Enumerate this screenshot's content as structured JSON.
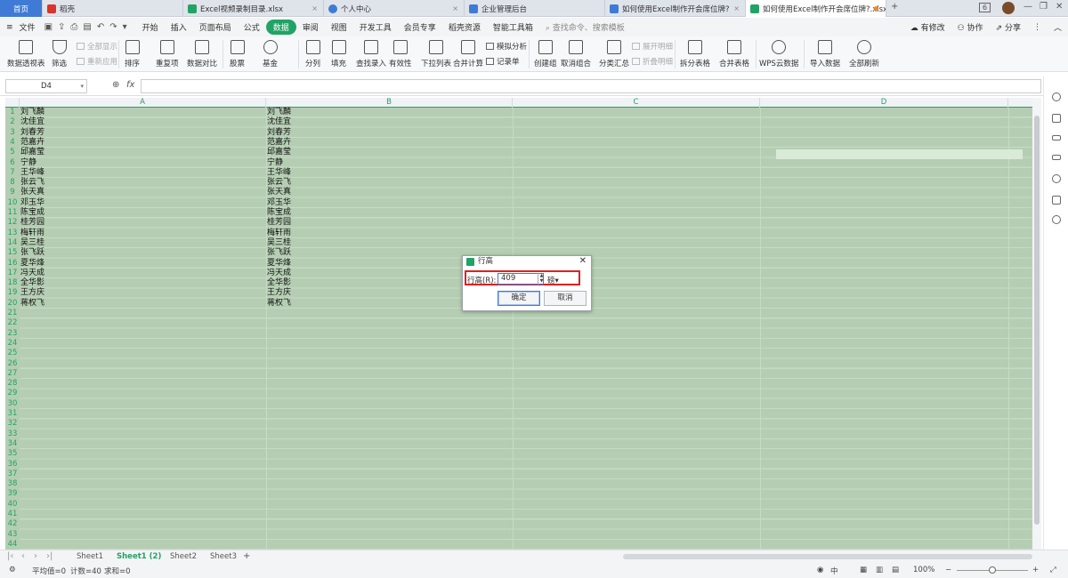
{
  "tabs": {
    "home": "首页",
    "docs": [
      {
        "label": "稻壳",
        "icon_color": "#d9342b",
        "closable": false
      },
      {
        "label": "Excel视频录制目录.xlsx",
        "icon_color": "#21a366",
        "closable": true
      },
      {
        "label": "个人中心",
        "icon_color": "#3f7bd6",
        "closable": true
      },
      {
        "label": "企业管理后台",
        "icon_color": "#3f7bd6",
        "closable": false
      },
      {
        "label": "如何使用Excel制作开会席位牌?",
        "icon_color": "#3f7bd6",
        "closable": true
      },
      {
        "label": "如何使用Excel制作开会席位牌?.xlsx",
        "icon_color": "#21a366",
        "active": true
      }
    ],
    "new_tab": "+",
    "window_badge": "6"
  },
  "menubar": {
    "file": "文件",
    "items": [
      "开始",
      "插入",
      "页面布局",
      "公式",
      "数据",
      "审阅",
      "视图",
      "开发工具",
      "会员专享",
      "稻壳资源",
      "智能工具箱"
    ],
    "active": "数据",
    "search_placeholder": "查找命令、搜索模板",
    "right": {
      "modified": "有修改",
      "collab": "协作",
      "share": "分享"
    }
  },
  "ribbon": {
    "pivot": "数据透视表",
    "filter": "筛选",
    "show_all": "全部显示",
    "reapply": "重新应用",
    "sort": "排序",
    "duplicates": "重复项",
    "compare": "数据对比",
    "stock": "股票",
    "fund": "基金",
    "split": "分列",
    "fill": "填充",
    "lookup": "查找录入",
    "validity": "有效性",
    "dropdown": "下拉列表",
    "consolidate": "合并计算",
    "simulate": "模拟分析",
    "record": "记录单",
    "group": "创建组",
    "ungroup": "取消组合",
    "subtotal": "分类汇总",
    "expand": "展开明细",
    "collapse": "折叠明细",
    "split_table": "拆分表格",
    "merge_table": "合并表格",
    "wps_cloud": "WPS云数据",
    "import": "导入数据",
    "refresh": "全部刷新"
  },
  "formula_bar": {
    "cell_ref": "D4",
    "fx": "fx",
    "value": ""
  },
  "columns": [
    "A",
    "B",
    "C",
    "D"
  ],
  "row_count": 44,
  "names": [
    "刘飞麟",
    "沈佳宜",
    "刘春芳",
    "范嘉卉",
    "邱嘉莹",
    "宁静",
    "王华峰",
    "张云飞",
    "张天真",
    "邓玉华",
    "陈宝成",
    "桂芳园",
    "梅轩雨",
    "吴三桂",
    "张飞跃",
    "夏华烽",
    "冯天成",
    "全华影",
    "王方庆",
    "蒋权飞"
  ],
  "sheets": [
    "Sheet1",
    "Sheet1 (2)",
    "Sheet2",
    "Sheet3"
  ],
  "active_sheet": "Sheet1 (2)",
  "status": {
    "avg": "平均值=0",
    "count": "计数=40",
    "sum": "求和=0",
    "zoom": "100%",
    "input": "中"
  },
  "dialog": {
    "title": "行高",
    "label": "行高(R):",
    "value": "409",
    "unit": "磅",
    "ok": "确定",
    "cancel": "取消",
    "highlight_color": "#e02020"
  },
  "colors": {
    "accent": "#21a366",
    "selection": "#b5ceb3",
    "active_cell": "#d9ead7",
    "home_tab": "#3f7bd6"
  }
}
